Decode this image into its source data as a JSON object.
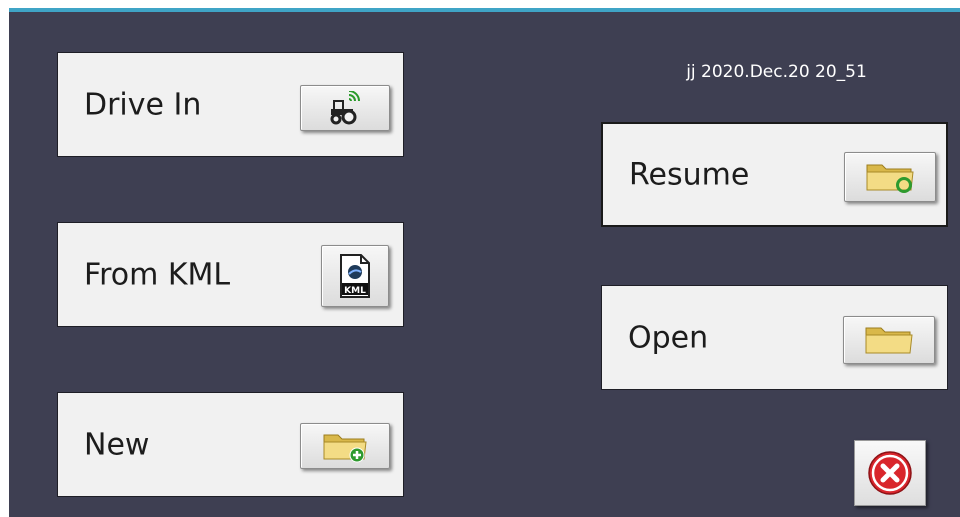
{
  "job": {
    "name": "jj 2020.Dec.20 20_51"
  },
  "buttons": {
    "drive_in": {
      "label": "Drive In",
      "icon": "tractor-icon"
    },
    "from_kml": {
      "label": "From KML",
      "icon": "kml-file-icon"
    },
    "new": {
      "label": "New",
      "icon": "folder-add-icon"
    },
    "resume": {
      "label": "Resume",
      "icon": "folder-resume-icon"
    },
    "open": {
      "label": "Open",
      "icon": "folder-open-icon"
    },
    "close": {
      "icon": "close-icon"
    }
  },
  "icon_texts": {
    "kml_badge": "KML"
  },
  "colors": {
    "background": "#3e3f52",
    "accent_border": "#3fa4c6",
    "tile": "#f1f1f1",
    "folder_yellow": "#e8c95a",
    "green": "#2e9a2e",
    "close_red": "#d9262c"
  }
}
